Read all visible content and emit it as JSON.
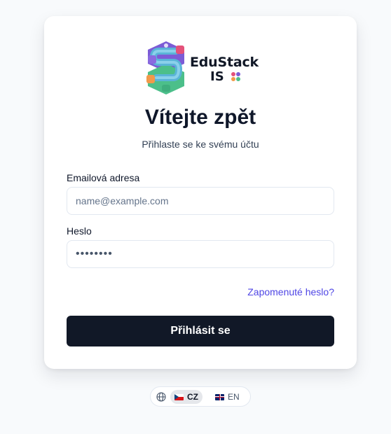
{
  "brand": {
    "name": "EduStack",
    "suffix": "IS"
  },
  "login": {
    "title": "Vítejte zpět",
    "subtitle": "Přihlaste se ke svému účtu",
    "email_label": "Emailová adresa",
    "email_placeholder": "name@example.com",
    "password_label": "Heslo",
    "password_value": "password",
    "forgot_link": "Zapomenuté heslo?",
    "submit_label": "Přihlásit se"
  },
  "language": {
    "icon": "globe-icon",
    "options": [
      {
        "code": "CZ",
        "flag": "czech-flag",
        "active": true
      },
      {
        "code": "EN",
        "flag": "uk-flag",
        "active": false
      }
    ]
  },
  "colors": {
    "primary_button": "#111827",
    "link": "#4f46e5",
    "background": "#f8fafc"
  }
}
